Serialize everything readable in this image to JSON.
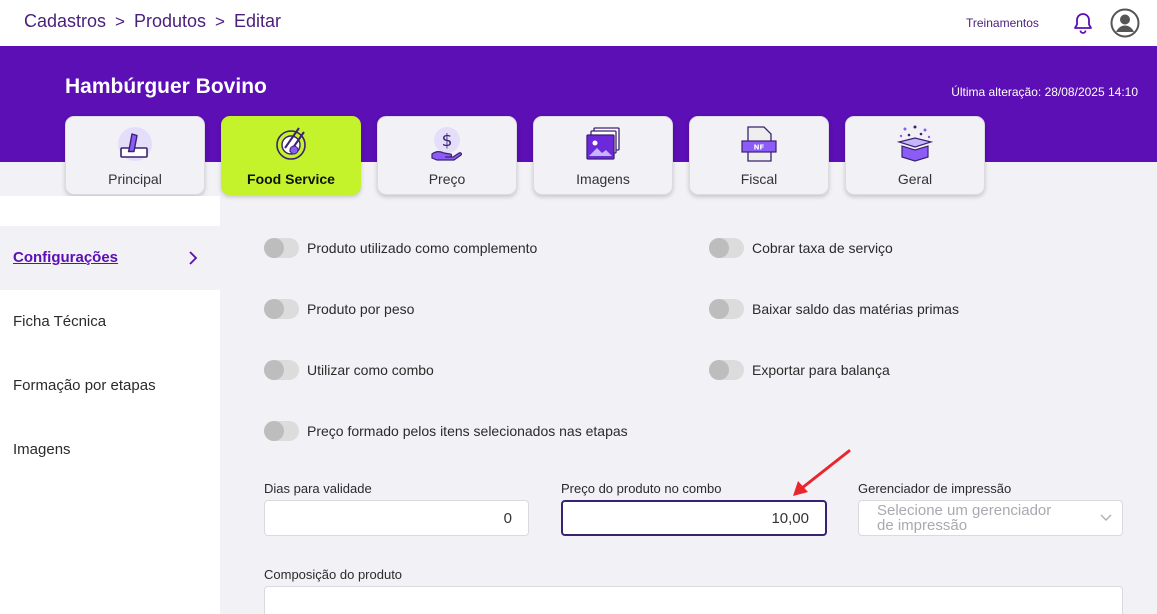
{
  "breadcrumb": [
    "Cadastros",
    "Produtos",
    "Editar"
  ],
  "topbar": {
    "training_label": "Treinamentos",
    "bell_icon": "bell-icon",
    "avatar_icon": "user-avatar-icon"
  },
  "hero": {
    "title": "Hambúrguer Bovino",
    "last_change_label": "Última alteração:",
    "last_change_value": "28/08/2025 14:10"
  },
  "tabs": [
    {
      "label": "Principal",
      "icon": "pencil-edit-icon",
      "active": false
    },
    {
      "label": "Food Service",
      "icon": "dish-cutlery-icon",
      "active": true
    },
    {
      "label": "Preço",
      "icon": "dollar-hand-icon",
      "active": false
    },
    {
      "label": "Imagens",
      "icon": "images-icon",
      "active": false
    },
    {
      "label": "Fiscal",
      "icon": "nf-document-icon",
      "active": false
    },
    {
      "label": "Geral",
      "icon": "open-box-icon",
      "active": false
    }
  ],
  "side_menu": [
    {
      "label": "Configurações",
      "active": true
    },
    {
      "label": "Ficha Técnica",
      "active": false
    },
    {
      "label": "Formação por etapas",
      "active": false
    },
    {
      "label": "Imagens",
      "active": false
    }
  ],
  "toggles": {
    "complemento": {
      "label": "Produto utilizado como complemento",
      "on": false
    },
    "taxa_servico": {
      "label": "Cobrar taxa de serviço",
      "on": false
    },
    "peso": {
      "label": "Produto por peso",
      "on": false
    },
    "materias_primas": {
      "label": "Baixar saldo das matérias primas",
      "on": false
    },
    "combo": {
      "label": "Utilizar como combo",
      "on": false
    },
    "balanca": {
      "label": "Exportar para balança",
      "on": false
    },
    "preco_etapas": {
      "label": "Preço formado pelos itens selecionados nas etapas",
      "on": false
    }
  },
  "fields": {
    "validade": {
      "label": "Dias para validade",
      "value": "0"
    },
    "preco_combo": {
      "label": "Preço do produto no combo",
      "value": "10,00"
    },
    "impressao": {
      "label": "Gerenciador de impressão",
      "placeholder": "Selecione um gerenciador de impressão"
    },
    "composicao": {
      "label": "Composição do produto",
      "value": ""
    }
  },
  "colors": {
    "brand_purple": "#5b0fb4",
    "active_tab": "#c4f22b",
    "annotation_arrow": "#e8262b"
  }
}
